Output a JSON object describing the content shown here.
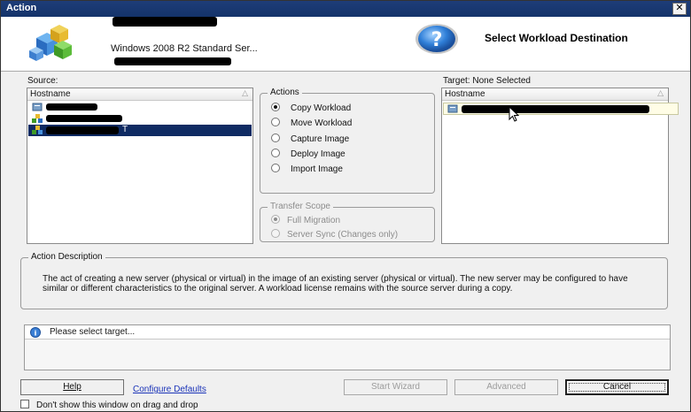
{
  "window": {
    "title": "Action",
    "close_label": "✕"
  },
  "header": {
    "server_os": "Windows 2008 R2 Standard Ser...",
    "title": "Select Workload Destination"
  },
  "source": {
    "label": "Source:",
    "column": "Hostname",
    "items": [
      {
        "label": "",
        "selected": false
      },
      {
        "label": "",
        "selected": false
      },
      {
        "label": "T",
        "selected": true
      }
    ]
  },
  "actions": {
    "title": "Actions",
    "options": [
      {
        "label": "Copy Workload",
        "checked": true
      },
      {
        "label": "Move Workload",
        "checked": false
      },
      {
        "label": "Capture Image",
        "checked": false
      },
      {
        "label": "Deploy Image",
        "checked": false
      },
      {
        "label": "Import Image",
        "checked": false
      }
    ]
  },
  "transfer_scope": {
    "title": "Transfer Scope",
    "options": [
      {
        "label": "Full Migration",
        "checked": true
      },
      {
        "label": "Server Sync (Changes only)",
        "checked": false
      }
    ]
  },
  "target": {
    "label": "Target: None Selected",
    "column": "Hostname",
    "items": [
      {
        "label": "",
        "selected": false
      }
    ]
  },
  "description": {
    "title": "Action Description",
    "text": "The act of creating a new server (physical or virtual) in the image of an existing server (physical or virtual).  The new server may be configured to have similar or different characteristics to the original server.  A workload license remains with the source server during a copy."
  },
  "status": {
    "message": "Please select target..."
  },
  "buttons": {
    "help": "Help",
    "configure_defaults": "Configure Defaults",
    "start_wizard": "Start Wizard",
    "advanced": "Advanced",
    "cancel": "Cancel"
  },
  "checkbox": {
    "label": "Don't show this window on drag and drop",
    "checked": false
  },
  "colors": {
    "titlebar": "#14336a",
    "selection": "#0f2b63",
    "link": "#1a33b8"
  }
}
